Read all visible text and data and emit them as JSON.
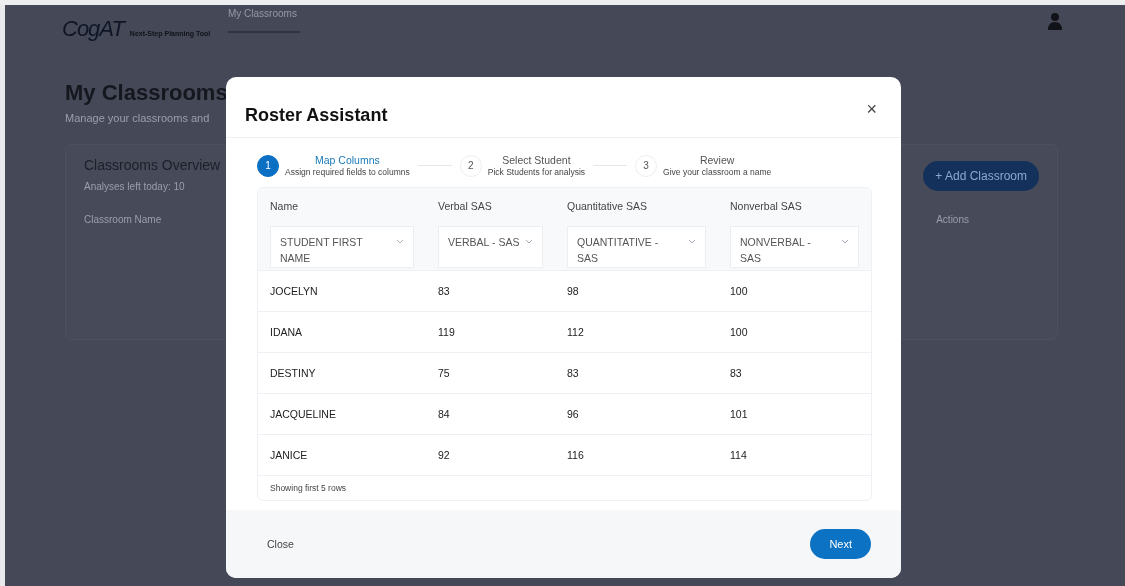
{
  "header": {
    "logo": "CogAT",
    "tagline": "Next-Step Planning Tool",
    "nav": [
      {
        "label": "My Classrooms",
        "selected": true
      }
    ]
  },
  "page": {
    "title": "My Classrooms",
    "subtitle": "Manage your classrooms and",
    "card": {
      "title": "Classrooms Overview",
      "note": "Analyses left today: 10",
      "add_button": "+ Add Classroom",
      "columns": [
        "Classroom Name",
        "Actions"
      ]
    }
  },
  "modal": {
    "title": "Roster Assistant",
    "close": "×",
    "steps": [
      {
        "number": "1",
        "title": "Map Columns",
        "subtitle": "Assign required fields to columns",
        "selected": true
      },
      {
        "number": "2",
        "title": "Select Student",
        "subtitle": "Pick Students for analysis",
        "selected": false
      },
      {
        "number": "3",
        "title": "Review",
        "subtitle": "Give your classroom a name",
        "selected": false
      }
    ],
    "table": {
      "columns": [
        "Name",
        "Verbal SAS",
        "Quantitative SAS",
        "Nonverbal SAS"
      ],
      "mappings": [
        "STUDENT FIRST NAME",
        "VERBAL - SAS",
        "QUANTITATIVE - SAS",
        "NONVERBAL - SAS"
      ],
      "rows": [
        [
          "JOCELYN",
          "83",
          "98",
          "100"
        ],
        [
          "IDANA",
          "119",
          "112",
          "100"
        ],
        [
          "DESTINY",
          "75",
          "83",
          "83"
        ],
        [
          "JACQUELINE",
          "84",
          "96",
          "101"
        ],
        [
          "JANICE",
          "92",
          "116",
          "114"
        ]
      ],
      "note": "Showing first 5 rows"
    },
    "footer": {
      "close": "Close",
      "next": "Next"
    }
  }
}
